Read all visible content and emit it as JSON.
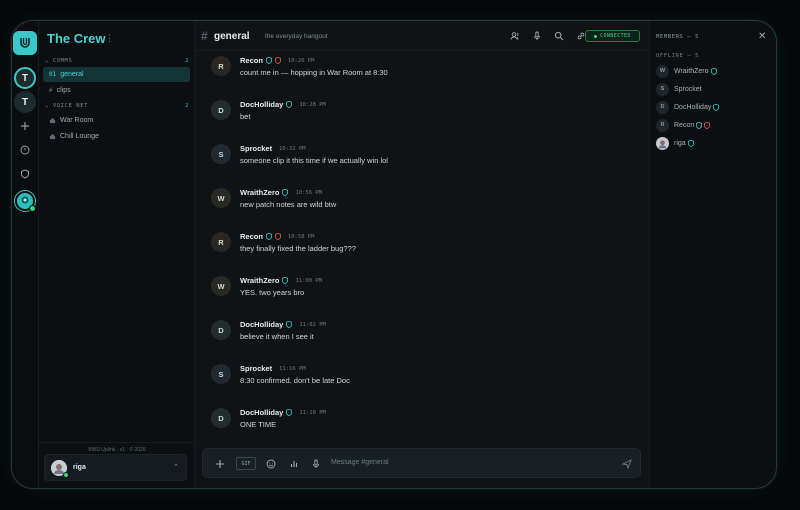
{
  "app": {
    "server_name": "The Crew",
    "colors": {
      "accent": "#3ec5c5",
      "online": "#3ad17a",
      "connected": "#45d17f",
      "shield": "#3ec5c5",
      "heart": "#e05a5a"
    }
  },
  "rail": {
    "servers": [
      {
        "initial": "T",
        "active": true
      },
      {
        "initial": "T",
        "active": false
      }
    ],
    "icons": [
      "plus-icon",
      "compass-icon",
      "shield-icon"
    ]
  },
  "channels": {
    "sections": [
      {
        "label": "COMMS",
        "count": "2"
      },
      {
        "label": "VOICE NET",
        "count": "2"
      }
    ],
    "text": [
      {
        "hash": "01",
        "label": "general",
        "active": true
      },
      {
        "hash": "#",
        "label": "clips",
        "active": false
      }
    ],
    "voice": [
      {
        "label": "War Room"
      },
      {
        "label": "Chill Lounge"
      }
    ],
    "version": "BWU Uplink · v1 · © 2026",
    "current_user": "riga"
  },
  "header": {
    "channel": "general",
    "topic": "the everyday hangout",
    "status": "CONNECTED"
  },
  "messages": [
    {
      "initial": "R",
      "author": "Recon",
      "badges": [
        "shield",
        "heart"
      ],
      "time": "10:26 PM",
      "text": "count me in — hopping in War Room at 8:30"
    },
    {
      "initial": "D",
      "author": "DocHolliday",
      "badges": [
        "shield"
      ],
      "time": "10:28 PM",
      "text": "bet"
    },
    {
      "initial": "S",
      "author": "Sprocket",
      "badges": [],
      "time": "10:32 PM",
      "text": "someone clip it this time if we actually win lol"
    },
    {
      "initial": "W",
      "author": "WraithZero",
      "badges": [
        "shield"
      ],
      "time": "10:56 PM",
      "text": "new patch notes are wild btw"
    },
    {
      "initial": "R",
      "author": "Recon",
      "badges": [
        "shield",
        "heart"
      ],
      "time": "10:58 PM",
      "text": "they finally fixed the ladder bug???"
    },
    {
      "initial": "W",
      "author": "WraithZero",
      "badges": [
        "shield"
      ],
      "time": "11:00 PM",
      "text": "YES. two years bro"
    },
    {
      "initial": "D",
      "author": "DocHolliday",
      "badges": [
        "shield"
      ],
      "time": "11:02 PM",
      "text": "believe it when I see it"
    },
    {
      "initial": "S",
      "author": "Sprocket",
      "badges": [],
      "time": "11:16 PM",
      "text": "8:30 confirmed. don't be late Doc"
    },
    {
      "initial": "D",
      "author": "DocHolliday",
      "badges": [
        "shield"
      ],
      "time": "11:18 PM",
      "text": "ONE TIME"
    }
  ],
  "composer": {
    "gif_label": "GIF",
    "placeholder": "Message #general"
  },
  "members": {
    "title": "MEMBERS — 5",
    "subtitle": "OFFLINE — 5",
    "list": [
      {
        "initial": "W",
        "name": "WraithZero",
        "badges": [
          "shield"
        ]
      },
      {
        "initial": "S",
        "name": "Sprocket",
        "badges": []
      },
      {
        "initial": "D",
        "name": "DocHolliday",
        "badges": [
          "shield"
        ]
      },
      {
        "initial": "R",
        "name": "Recon",
        "badges": [
          "shield",
          "heart"
        ]
      },
      {
        "initial": "",
        "name": "riga",
        "badges": [
          "shield"
        ]
      }
    ]
  }
}
